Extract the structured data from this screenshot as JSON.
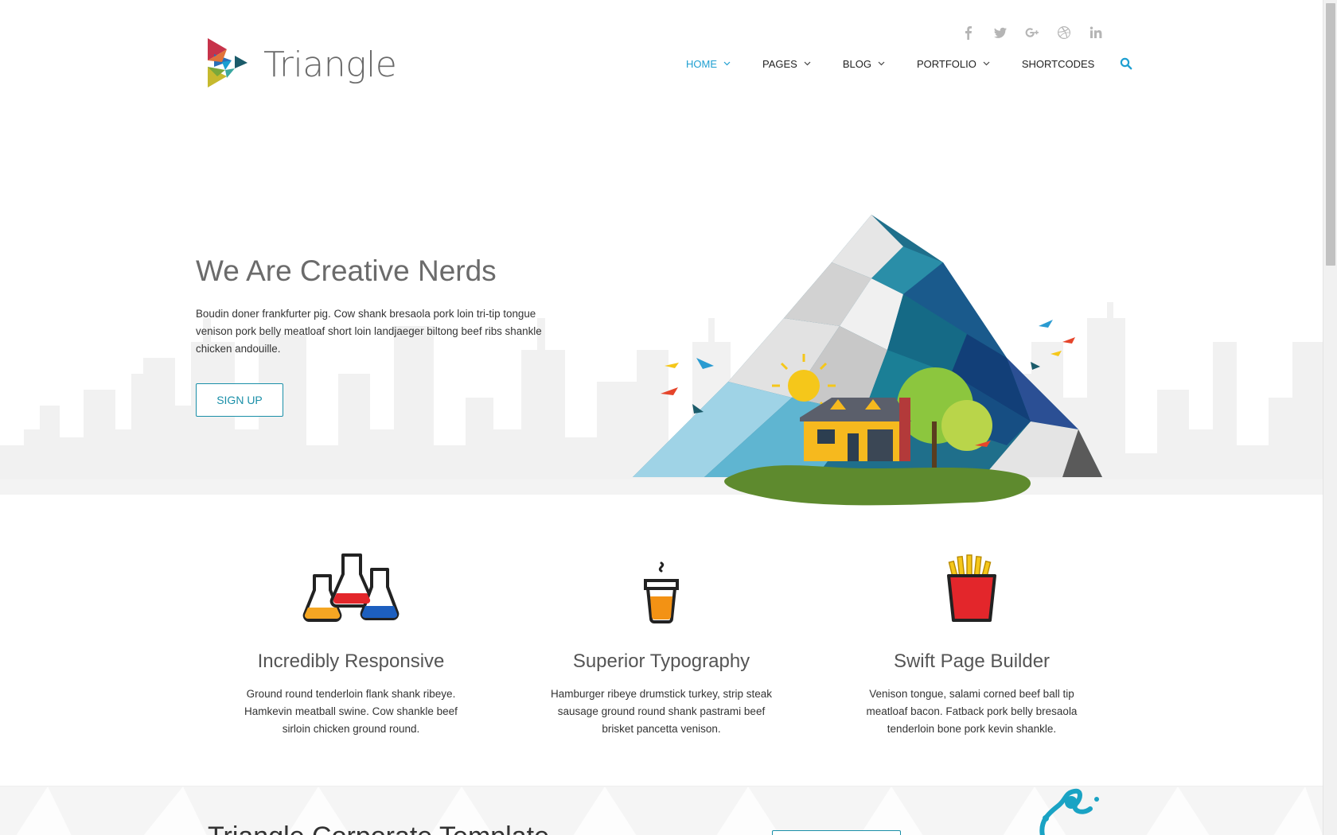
{
  "brand": {
    "name": "Triangle"
  },
  "social": [
    {
      "icon": "facebook-icon"
    },
    {
      "icon": "twitter-icon"
    },
    {
      "icon": "google-plus-icon"
    },
    {
      "icon": "dribbble-icon"
    },
    {
      "icon": "linkedin-icon"
    }
  ],
  "nav": {
    "items": [
      {
        "label": "HOME",
        "active": true
      },
      {
        "label": "PAGES"
      },
      {
        "label": "BLOG"
      },
      {
        "label": "PORTFOLIO"
      },
      {
        "label": "SHORTCODES"
      }
    ],
    "search_icon": "search-icon"
  },
  "hero": {
    "title": "We Are Creative Nerds",
    "text": "Boudin doner frankfurter pig. Cow shank bresaola pork loin tri-tip tongue venison pork belly meatloaf short loin landjaeger biltong beef ribs shankle chicken andouille.",
    "button": "SIGN UP"
  },
  "features": [
    {
      "icon": "flasks-icon",
      "title": "Incredibly Responsive",
      "text": "Ground round tenderloin flank shank ribeye. Hamkevin meatball swine. Cow shankle beef sirloin chicken ground round."
    },
    {
      "icon": "coffee-cup-icon",
      "title": "Superior Typography",
      "text": "Hamburger ribeye drumstick turkey, strip steak sausage ground round shank pastrami beef brisket pancetta venison."
    },
    {
      "icon": "fries-icon",
      "title": "Swift Page Builder",
      "text": "Venison tongue, salami corned beef ball tip meatloaf bacon. Fatback pork belly bresaola tenderloin bone pork kevin shankle."
    }
  ],
  "band": {
    "title": "Triangle Corporate Template"
  },
  "colors": {
    "accent": "#1e9fd1",
    "button_border": "#1a8fa8",
    "band_bg": "#f5f5f5"
  }
}
